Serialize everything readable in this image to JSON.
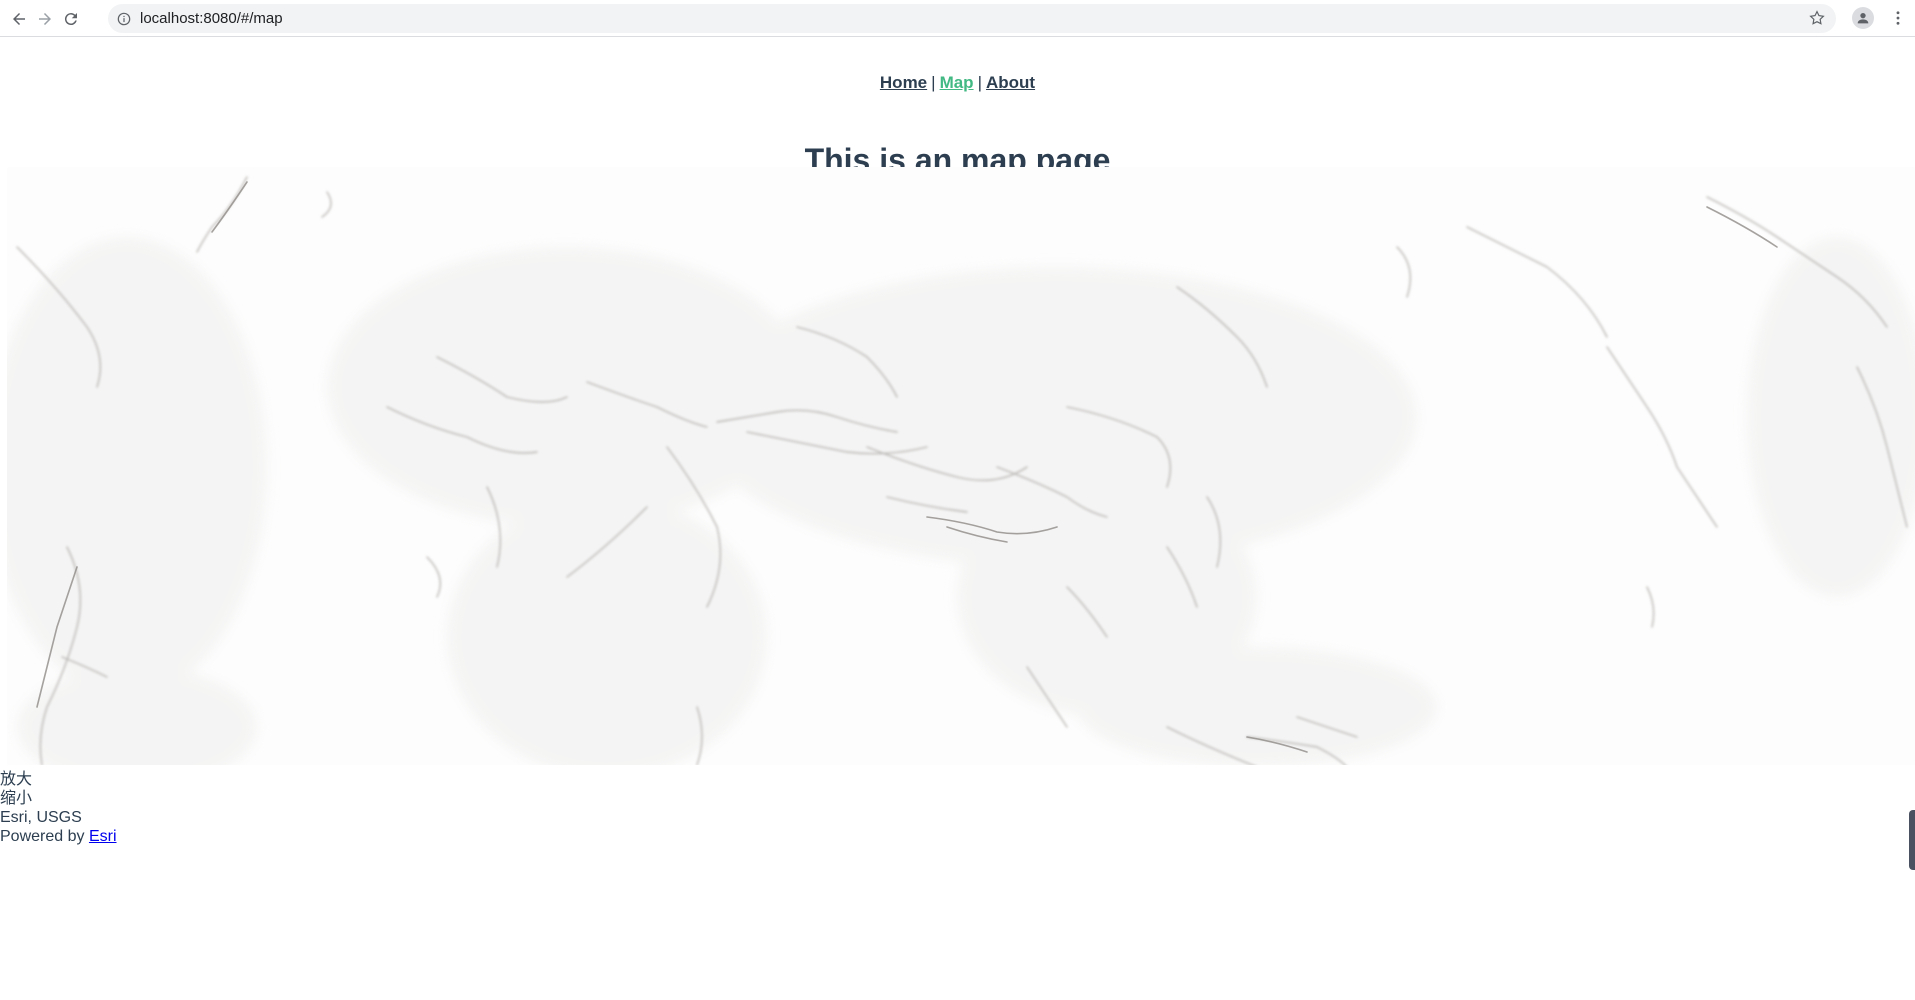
{
  "browser": {
    "url": "localhost:8080/#/map"
  },
  "nav": {
    "home": "Home",
    "separator": "|",
    "map": "Map",
    "about": "About"
  },
  "page": {
    "title": "This is an map page"
  },
  "map_controls": {
    "zoom_in": "放大",
    "zoom_out": "缩小"
  },
  "attribution": {
    "sources": "Esri, USGS",
    "powered_by": "Powered by",
    "esri_link": "Esri"
  },
  "colors": {
    "text": "#2c3e50",
    "active_link": "#42b983",
    "link": "#0000ee"
  },
  "icons": {
    "back": "back-arrow-icon",
    "forward": "forward-arrow-icon",
    "reload": "reload-icon",
    "info": "info-icon",
    "bookmark": "star-icon",
    "profile": "profile-icon",
    "menu": "menu-dots-icon"
  }
}
